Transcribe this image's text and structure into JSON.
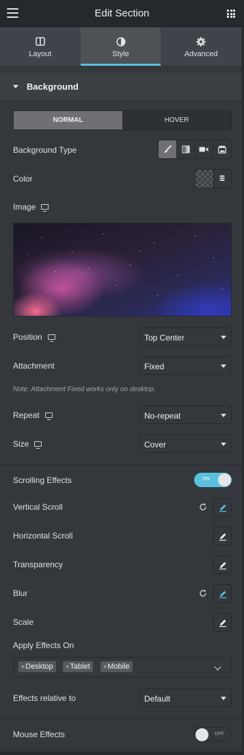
{
  "header": {
    "title": "Edit Section",
    "menu_icon": "hamburger-icon",
    "apps_icon": "grid-icon"
  },
  "tabs": [
    {
      "label": "Layout",
      "icon": "columns-icon",
      "active": false
    },
    {
      "label": "Style",
      "icon": "contrast-icon",
      "active": true
    },
    {
      "label": "Advanced",
      "icon": "gear-icon",
      "active": false
    }
  ],
  "accent_color": "#5bc0de",
  "background_section": {
    "title": "Background",
    "state_tabs": [
      {
        "label": "NORMAL",
        "active": true
      },
      {
        "label": "HOVER",
        "active": false
      }
    ],
    "background_type_label": "Background Type",
    "background_type_options": [
      "brush-icon",
      "gradient-icon",
      "video-icon",
      "slideshow-icon"
    ],
    "color_label": "Color",
    "image_label": "Image",
    "position": {
      "label": "Position",
      "value": "Top Center"
    },
    "attachment": {
      "label": "Attachment",
      "value": "Fixed"
    },
    "note": "Note: Attachment Fixed works only on desktop.",
    "repeat": {
      "label": "Repeat",
      "value": "No-repeat"
    },
    "size": {
      "label": "Size",
      "value": "Cover"
    }
  },
  "scrolling": {
    "label": "Scrolling Effects",
    "toggle_text": "ON",
    "enabled": true,
    "effects": [
      {
        "label": "Vertical Scroll",
        "has_reset": true
      },
      {
        "label": "Horizontal Scroll",
        "has_reset": false
      },
      {
        "label": "Transparency",
        "has_reset": false
      },
      {
        "label": "Blur",
        "has_reset": true
      },
      {
        "label": "Scale",
        "has_reset": false
      }
    ],
    "apply_label": "Apply Effects On",
    "devices": [
      "Desktop",
      "Tablet",
      "Mobile"
    ],
    "relative": {
      "label": "Effects relative to",
      "value": "Default"
    }
  },
  "mouse": {
    "label": "Mouse Effects",
    "toggle_text": "OFF",
    "enabled": false
  }
}
